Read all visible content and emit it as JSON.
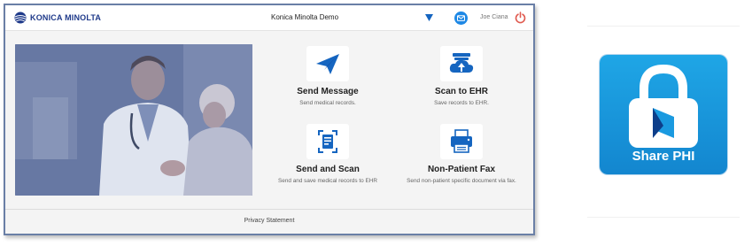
{
  "header": {
    "brand": "KONICA MINOLTA",
    "app_title": "Konica Minolta Demo",
    "user_name": "Joe Ciana",
    "icons": {
      "dropdown": "caret-down-icon",
      "mail": "mail-icon",
      "power": "power-icon"
    }
  },
  "tiles": [
    {
      "title": "Send Message",
      "description": "Send medical records.",
      "icon": "paper-plane-icon"
    },
    {
      "title": "Scan to EHR",
      "description": "Save records to EHR.",
      "icon": "cloud-upload-icon"
    },
    {
      "title": "Send and Scan",
      "description": "Send and save medical records to EHR",
      "icon": "document-scan-icon"
    },
    {
      "title": "Non-Patient Fax",
      "description": "Send non-patient specific document via fax.",
      "icon": "fax-icon"
    }
  ],
  "footer": {
    "privacy_label": "Privacy Statement"
  },
  "share_phi": {
    "label": "Share PHI",
    "icon": "lock-icon"
  },
  "colors": {
    "brand_blue": "#1f3a8a",
    "icon_blue": "#1565c0",
    "power_red": "#e05a4f",
    "share_phi_blue": "#1a9ae0",
    "window_border": "#6a7fa6"
  }
}
